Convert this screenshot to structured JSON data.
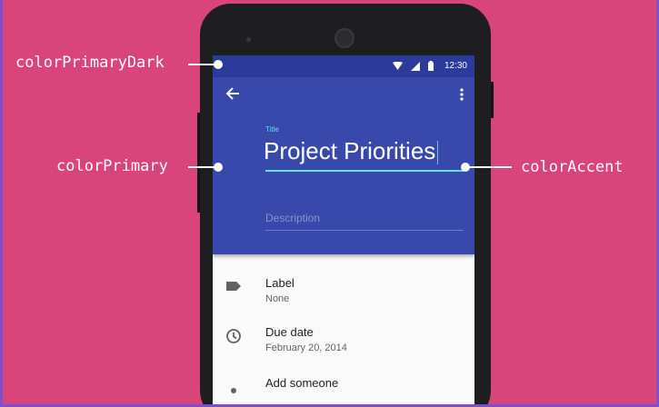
{
  "statusbar": {
    "time": "12:30"
  },
  "form": {
    "title_label": "Title",
    "title_value": "Project Priorities",
    "description_placeholder": "Description"
  },
  "list": [
    {
      "primary": "Label",
      "secondary": "None",
      "icon": "label-tag-icon"
    },
    {
      "primary": "Due date",
      "secondary": "February 20, 2014",
      "icon": "clock-icon"
    },
    {
      "primary": "Add someone",
      "secondary": "",
      "icon": "person-icon"
    }
  ],
  "callouts": {
    "primary_dark": "colorPrimaryDark",
    "primary": "colorPrimary",
    "accent": "colorAccent"
  },
  "colors": {
    "background": "#d9457a",
    "primary_dark": "#2c3a9c",
    "primary": "#3949ab",
    "accent": "#5fe3e3"
  }
}
